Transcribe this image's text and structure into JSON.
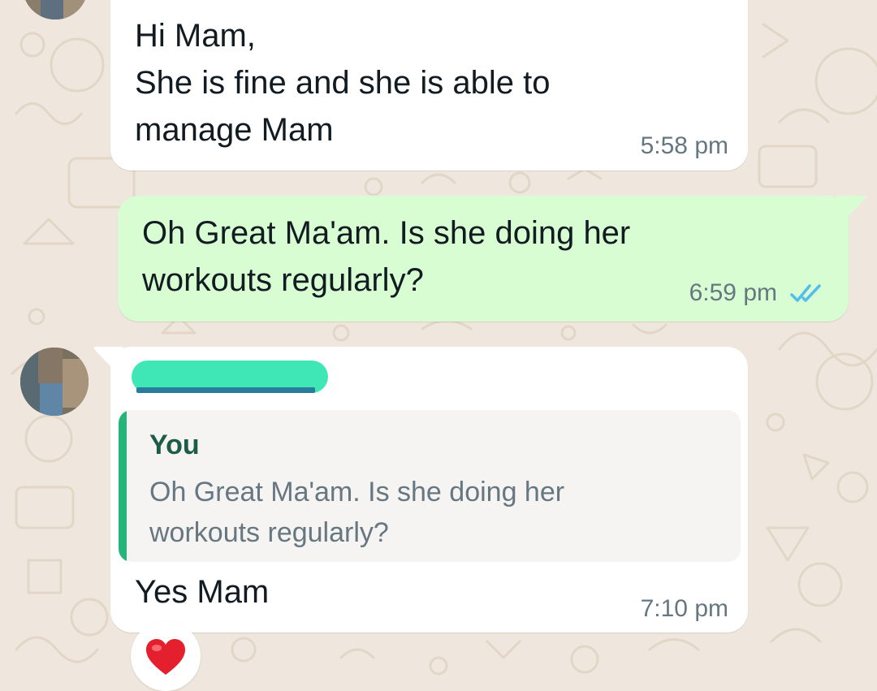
{
  "colors": {
    "wallpaper": "#efe7dd",
    "incoming_bubble": "#ffffff",
    "outgoing_bubble": "#d9fdd3",
    "text": "#111b21",
    "timestamp": "#667781",
    "read_ticks": "#53bdeb",
    "quote_bar": "#25b47a",
    "quote_author": "#1d5c48",
    "redaction": "#3fe7b6"
  },
  "messages": [
    {
      "direction": "incoming",
      "text": "Hi Mam,\nShe is fine and she is able to\nmanage Mam",
      "time": "5:58 pm"
    },
    {
      "direction": "outgoing",
      "text": "Oh Great Ma'am. Is she doing her\nworkouts regularly?",
      "time": "6:59 pm",
      "status_icon": "double-check-read-icon"
    },
    {
      "direction": "incoming",
      "sender_name_redacted": true,
      "quoted": {
        "author": "You",
        "text": "Oh Great Ma'am. Is she doing her\nworkouts regularly?"
      },
      "text": "Yes Mam",
      "time": "7:10 pm",
      "reaction": "heart-reaction-icon"
    }
  ]
}
